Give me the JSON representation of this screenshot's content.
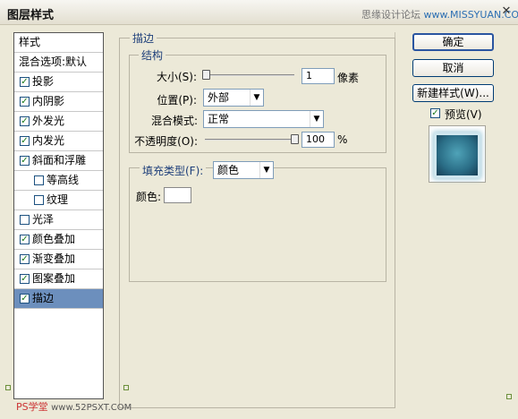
{
  "window": {
    "title": "图层样式",
    "watermark": "思缘设计论坛 ",
    "watermark_url": "www.MISSYUAN.COM",
    "close_symbol": "✕"
  },
  "sidebar": {
    "items": [
      {
        "label": "样式",
        "checkbox": false
      },
      {
        "label": "混合选项:默认",
        "checkbox": false
      },
      {
        "label": "投影",
        "checkbox": true,
        "checked": true
      },
      {
        "label": "内阴影",
        "checkbox": true,
        "checked": true
      },
      {
        "label": "外发光",
        "checkbox": true,
        "checked": true
      },
      {
        "label": "内发光",
        "checkbox": true,
        "checked": true
      },
      {
        "label": "斜面和浮雕",
        "checkbox": true,
        "checked": true
      },
      {
        "label": "等高线",
        "checkbox": true,
        "checked": false
      },
      {
        "label": "纹理",
        "checkbox": true,
        "checked": false
      },
      {
        "label": "光泽",
        "checkbox": true,
        "checked": false
      },
      {
        "label": "颜色叠加",
        "checkbox": true,
        "checked": true
      },
      {
        "label": "渐变叠加",
        "checkbox": true,
        "checked": true
      },
      {
        "label": "图案叠加",
        "checkbox": true,
        "checked": true
      },
      {
        "label": "描边",
        "checkbox": true,
        "checked": true,
        "selected": true
      }
    ]
  },
  "stroke": {
    "title": "描边",
    "structure_title": "结构",
    "size_label": "大小(S):",
    "size_value": "1",
    "size_unit": "像素",
    "position_label": "位置(P):",
    "position_value": "外部",
    "blend_label": "混合模式:",
    "blend_value": "正常",
    "opacity_label": "不透明度(O):",
    "opacity_value": "100",
    "opacity_unit": "%",
    "fill_type_label": "填充类型(F):",
    "fill_type_value": "颜色",
    "color_label": "颜色:",
    "color_value": "#ffffff"
  },
  "buttons": {
    "ok": "确定",
    "cancel": "取消",
    "new_style": "新建样式(W)...",
    "preview_label": "预览(V)"
  },
  "footer": {
    "watermark_left": "PS学堂",
    "watermark_url": "www.52PSXT.COM"
  },
  "colors": {
    "dialog_bg": "#ece9d8",
    "selected_item": "#6c8fbd",
    "group_title": "#1e3f7a"
  },
  "checkmark": "✓",
  "dropdown_arrow": "▼"
}
